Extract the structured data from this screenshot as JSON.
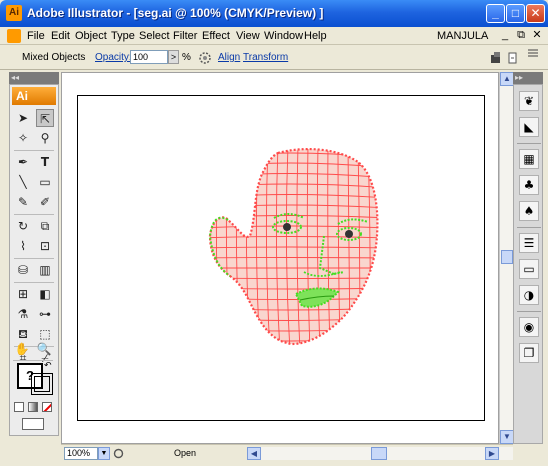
{
  "window": {
    "app_icon": "Ai",
    "title": "Adobe Illustrator - [seg.ai @ 100% (CMYK/Preview) ]",
    "minimize": "_",
    "maximize": "□",
    "close": "✕"
  },
  "menu": {
    "items": [
      "File",
      "Edit",
      "Object",
      "Type",
      "Select",
      "Filter",
      "Effect",
      "View",
      "Window",
      "Help"
    ],
    "user": "MANJULA",
    "mdi_minimize": "_",
    "mdi_restore": "⧉",
    "mdi_close": "✕"
  },
  "control": {
    "selection": "Mixed Objects",
    "opacity_label": "Opacity:",
    "opacity_value": "100",
    "opacity_arrow": ">",
    "percent": "%",
    "align": "Align",
    "transform": "Transform"
  },
  "toolbox": {
    "collapse": "◂◂",
    "logo": "Ai",
    "fill_placeholder": "?"
  },
  "dock": {
    "collapse": "▸▸"
  },
  "status": {
    "zoom": "100%",
    "zoom_arrow": "▼",
    "status_text": "Open"
  },
  "scrollbar": {
    "up": "▲",
    "down": "▼",
    "left": "◀",
    "right": "▶"
  },
  "colors": {
    "mesh_red": "#ff4a4a",
    "mesh_green": "#44dd22",
    "mesh_fill": "#f9d6ce",
    "title_blue": "#1e64e0",
    "ai_orange": "#ff9a00"
  }
}
